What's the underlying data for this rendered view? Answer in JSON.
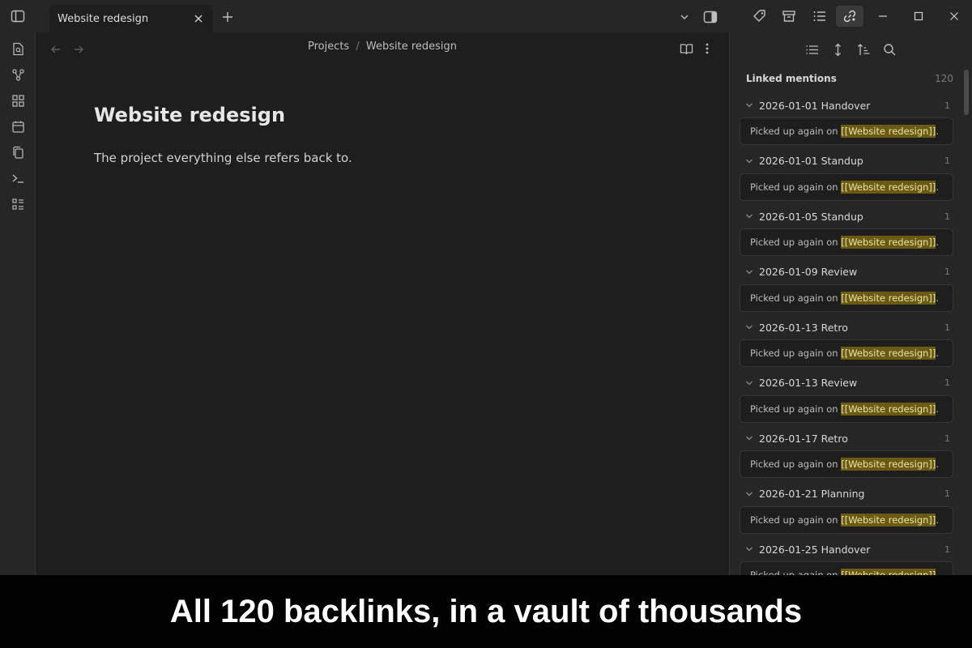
{
  "tab": {
    "title": "Website redesign"
  },
  "window_controls": {
    "minimize": "—",
    "maximize": "☐",
    "close": "✕"
  },
  "breadcrumb": {
    "parent": "Projects",
    "separator": "/",
    "current": "Website redesign"
  },
  "note": {
    "title": "Website redesign",
    "body": "The project everything else refers back to."
  },
  "ribbon_icons": [
    "file-search-icon",
    "graph-icon",
    "grid-icon",
    "calendar-icon",
    "copy-icon",
    "terminal-icon",
    "list-icon"
  ],
  "sidebar_tools": [
    "list-icon",
    "expand-icon",
    "sort-icon",
    "search-icon"
  ],
  "linked_mentions": {
    "title": "Linked mentions",
    "count": "120",
    "groups": [
      {
        "title": "2026-01-01 Handover",
        "count": "1",
        "prefix": "Picked up again on ",
        "link": "[[Website redesign]]",
        "suffix": "."
      },
      {
        "title": "2026-01-01 Standup",
        "count": "1",
        "prefix": "Picked up again on ",
        "link": "[[Website redesign]]",
        "suffix": "."
      },
      {
        "title": "2026-01-05 Standup",
        "count": "1",
        "prefix": "Picked up again on ",
        "link": "[[Website redesign]]",
        "suffix": "."
      },
      {
        "title": "2026-01-09 Review",
        "count": "1",
        "prefix": "Picked up again on ",
        "link": "[[Website redesign]]",
        "suffix": "."
      },
      {
        "title": "2026-01-13 Retro",
        "count": "1",
        "prefix": "Picked up again on ",
        "link": "[[Website redesign]]",
        "suffix": "."
      },
      {
        "title": "2026-01-13 Review",
        "count": "1",
        "prefix": "Picked up again on ",
        "link": "[[Website redesign]]",
        "suffix": "."
      },
      {
        "title": "2026-01-17 Retro",
        "count": "1",
        "prefix": "Picked up again on ",
        "link": "[[Website redesign]]",
        "suffix": "."
      },
      {
        "title": "2026-01-21 Planning",
        "count": "1",
        "prefix": "Picked up again on ",
        "link": "[[Website redesign]]",
        "suffix": "."
      },
      {
        "title": "2026-01-25 Handover",
        "count": "1",
        "prefix": "Picked up again on ",
        "link": "[[Website redesign]]",
        "suffix": "."
      }
    ]
  },
  "caption": "All 120 backlinks, in a vault of thousands",
  "colors": {
    "background": "#1e1e1e",
    "panel": "#262626",
    "highlight": "#6b5a14",
    "caption_bg": "#000000"
  }
}
